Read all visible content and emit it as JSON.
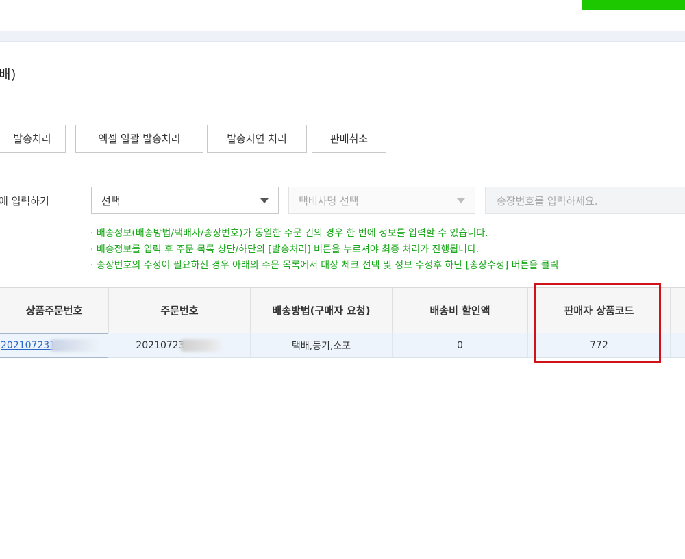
{
  "header": {
    "section_title": "배)"
  },
  "actions": {
    "ship": "발송처리",
    "excel_bulk_ship": "엑셀 일괄 발송처리",
    "delay_ship": "발송지연 처리",
    "cancel_sale": "판매취소"
  },
  "bulk_input": {
    "label": "에 입력하기",
    "delivery_method": {
      "selected": "선택"
    },
    "courier": {
      "placeholder": "택배사명 선택"
    },
    "invoice": {
      "placeholder": "송장번호를 입력하세요."
    }
  },
  "notices": [
    "· 배송정보(배송방법/택배사/송장번호)가 동일한 주문 건의 경우 한 번에 정보를 입력할 수 있습니다.",
    "· 배송정보를 입력 후 주문 목록 상단/하단의 [발송처리] 버튼을 누르셔야 최종 처리가 진행됩니다.",
    "· 송장번호의 수정이 필요하신 경우 아래의 주문 목록에서 대상 체크 선택 및 정보 수정후 하단 [송장수정] 버튼을 클릭"
  ],
  "table": {
    "columns": [
      "상품주문번호",
      "주문번호",
      "배송방법(구매자 요청)",
      "배송비 할인액",
      "판매자 상품코드"
    ],
    "rows": [
      {
        "product_order_no": "2021072318",
        "order_no": "20210723",
        "delivery_method": "택배,등기,소포",
        "shipping_discount": "0",
        "seller_product_code": "772"
      }
    ]
  },
  "colors": {
    "accent_green": "#1ec800",
    "notice_green": "#1aa81a",
    "highlight_red": "#d0121b",
    "link_blue": "#2b67c4"
  }
}
